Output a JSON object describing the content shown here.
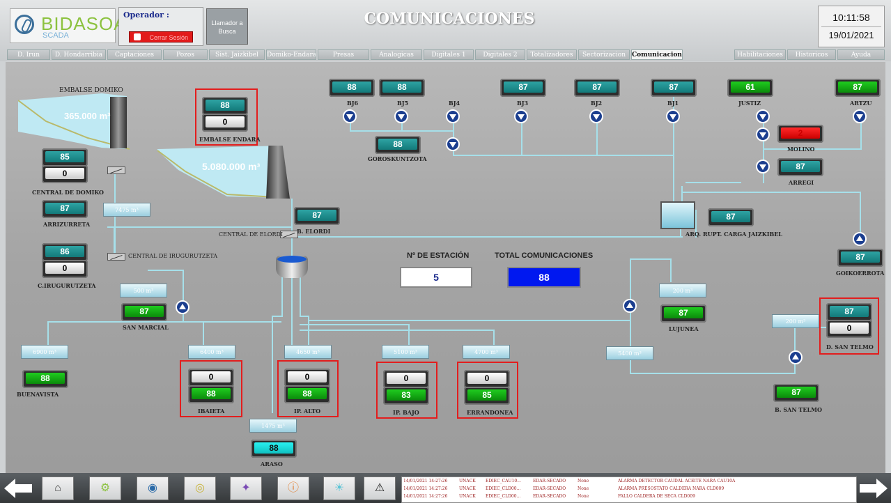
{
  "header": {
    "brand": "BIDASOA",
    "brand_sub": "SCADA",
    "operator_label": "Operador :",
    "logout_label": "Cerrar Sesión",
    "call_button": "Llamador a Busca",
    "title": "COMUNICACIONES",
    "time": "10:11:58",
    "date": "19/01/2021"
  },
  "tabs": [
    "D. Irun",
    "D. Hondarribia",
    "Captaciones",
    "Pozos",
    "Sist. Jaizkibel",
    "Domiko-Endara",
    "Presas",
    "Analogicas",
    "Digitales 1",
    "Digitales 2",
    "Totalizadores",
    "Sectorizacion",
    "Comunicaciones",
    "Habilitaciones",
    "Historicos",
    "Ayuda"
  ],
  "active_tab": "Comunicaciones",
  "reservoirs": {
    "domiko": {
      "name": "EMBALSE DOMIKO",
      "volume": "365.000 m³"
    },
    "elordi": {
      "volume": "5.080.000 m³"
    }
  },
  "stations": {
    "endara": {
      "label": "EMBALSE ENDARA",
      "top": "88",
      "bottom": "0"
    },
    "central_domiko": {
      "label": "CENTRAL DE DOMIKO",
      "top": "85",
      "bottom": "0"
    },
    "arrizurreta": {
      "label": "ARRIZURRETA",
      "value": "87"
    },
    "c_irugurutzeta": {
      "label": "C.IRUGURUTZETA",
      "top": "86",
      "bottom": "0"
    },
    "bj6": {
      "label": "BJ6",
      "value": "88"
    },
    "bj5": {
      "label": "BJ5",
      "value": "88"
    },
    "bj4": {
      "label": "BJ4"
    },
    "bj3": {
      "label": "BJ3",
      "value": "87"
    },
    "bj2": {
      "label": "BJ2",
      "value": "87"
    },
    "bj1": {
      "label": "BJ1",
      "value": "87"
    },
    "justiz": {
      "label": "JUSTIZ",
      "value": "61"
    },
    "artzu": {
      "label": "ARTZU",
      "value": "87"
    },
    "molino": {
      "label": "MOLINO",
      "value": "2"
    },
    "arregi": {
      "label": "ARREGI",
      "value": "87"
    },
    "goroskuntzota": {
      "label": "GOROSKUNTZOTA",
      "value": "88"
    },
    "b_elordi": {
      "label": "B. ELORDI",
      "value": "87"
    },
    "arq": {
      "label": "ARQ. RUPT. CARGA JAIZKIBEL",
      "value": "87"
    },
    "goikoerrota": {
      "label": "GOIKOERROTA",
      "value": "87"
    },
    "san_marcial": {
      "label": "SAN MARCIAL",
      "value": "87"
    },
    "lujunea": {
      "label": "LUJUNEA",
      "value": "87"
    },
    "d_san_telmo": {
      "label": "D. SAN TELMO",
      "top": "87",
      "bottom": "0"
    },
    "b_san_telmo": {
      "label": "B. SAN TELMO",
      "value": "87"
    },
    "buenavista": {
      "label": "BUENAVISTA",
      "value": "88"
    },
    "ibaieta": {
      "label": "IBAIETA",
      "top": "0",
      "bottom": "88"
    },
    "ip_alto": {
      "label": "IP. ALTO",
      "top": "0",
      "bottom": "88"
    },
    "ip_bajo": {
      "label": "IP. BAJO",
      "top": "0",
      "bottom": "83"
    },
    "errandonea": {
      "label": "ERRANDONEA",
      "top": "0",
      "bottom": "85"
    },
    "araso": {
      "label": "ARASO",
      "value": "88"
    }
  },
  "volumes": {
    "v7475": "7475 m³",
    "v500": "500 m³",
    "v200": "200 m³",
    "v200b": "200 m³",
    "v6900": "6900 m³",
    "v6400": "6400 m³",
    "v4650": "4650 m³",
    "v5100": "5100 m³",
    "v4700": "4700 m³",
    "v5400": "5400 m³",
    "v1475": "1475 m³"
  },
  "labels": {
    "central_elordi": "CENTRAL DE ELORDI",
    "central_irugurutzeta": "CENTRAL DE IRUGURUTZETA"
  },
  "summary": {
    "station_label": "Nº DE ESTACIÓN",
    "station_value": "5",
    "total_label": "TOTAL COMUNICACIONES",
    "total_value": "88"
  },
  "alarms": [
    {
      "time": "14/01/2021 14:27:26",
      "state": "UNACK",
      "tag": "EDIEC_CAU10...",
      "area": "EDAR-SECADO",
      "prio": "None",
      "msg": "ALARMA DETECTOR CAUDAL ACEITE NARA CAU10A"
    },
    {
      "time": "14/01/2021 14:27:26",
      "state": "UNACK",
      "tag": "EDIEC_CLD00...",
      "area": "EDAR-SECADO",
      "prio": "None",
      "msg": "ALARMA PRESOSTATO CALDERA NARA CLD009"
    },
    {
      "time": "14/01/2021 14:27:26",
      "state": "UNACK",
      "tag": "EDIEC_CLD00...",
      "area": "EDAR-SECADO",
      "prio": "None",
      "msg": "FALLO CALDERA DE SECA CLD009"
    }
  ],
  "colors": {
    "teal": "#1a8a8a",
    "green": "#12a812",
    "red": "#e31d1d",
    "pipe": "#a6e0ea",
    "blue": "#0018f0"
  }
}
